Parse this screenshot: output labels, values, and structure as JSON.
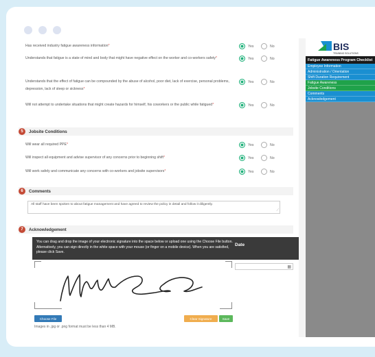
{
  "questions": [
    {
      "text": "Has received industry fatigue awareness information",
      "required": "*",
      "yes": "Yes",
      "no": "No"
    },
    {
      "text": "Understands that fatigue is a state of mind and body that might have negative effect on the worker and co-workers safety",
      "required": "*",
      "yes": "Yes",
      "no": "No"
    },
    {
      "text": "Understands that the effect of fatigue can be compounded by the abuse of alcohol, poor diet, lack of exercise, personal problems, depression, lack of sleep or sickness",
      "required": "*",
      "yes": "Yes",
      "no": "No"
    },
    {
      "text": "Will not attempt to undertake situations that might create hazards for himself, his coworkers or the public while fatigued",
      "required": "*",
      "yes": "Yes",
      "no": "No"
    }
  ],
  "sections": {
    "jobsite": {
      "number": "5",
      "title": "Jobsite Conditions"
    },
    "comments": {
      "number": "6",
      "title": "Comments"
    },
    "ack": {
      "number": "7",
      "title": "Acknowledgement"
    }
  },
  "jobsite_questions": [
    {
      "text": "Will wear all required PPE",
      "required": "*",
      "yes": "Yes",
      "no": "No"
    },
    {
      "text": "Will inspect all equipment and advise supervisor of any concerns prior to beginning shift",
      "required": "*",
      "yes": "Yes",
      "no": "No"
    },
    {
      "text": "Will work safely and communicate any concerns with co-workers and jobsite supervisors",
      "required": "*",
      "yes": "Yes",
      "no": "No"
    }
  ],
  "comments_value": "All staff have been spoken to about fatigue management and have agreed to review the policy in detail and follow it diligently.",
  "ack": {
    "instructions": "You can drag and drop the image of your electronic signature into the space below or upload one using the Choose File button. Alternatively, you can sign directly in the white space with your mouse (or finger on a mobile device). When you are satisfied, please click Save.",
    "date_label": "Date",
    "choose_file": "Choose File",
    "clear_signature": "Clear Signature",
    "save": "Save",
    "file_note": "Images in .jpg or .png format must be less than 4 MB."
  },
  "sidebar": {
    "logo_text": "BIS",
    "logo_sub": "TRAINING SOLUTIONS",
    "title": "Fatigue Awareness Program Checklist",
    "items": [
      {
        "label": "Employee Information",
        "color": "#1a8fd1"
      },
      {
        "label": "Administration / Orientation",
        "color": "#1a8fd1"
      },
      {
        "label": "Shift Duration Requirement",
        "color": "#1a8fd1"
      },
      {
        "label": "Fatigue Awareness",
        "color": "#1fa24a"
      },
      {
        "label": "Jobsite Conditions",
        "color": "#1fa24a"
      },
      {
        "label": "Comments",
        "color": "#1a8fd1"
      },
      {
        "label": "Acknowledgement",
        "color": "#1a8fd1"
      }
    ]
  },
  "colors": {
    "accent_green": "#1fb17a",
    "section_badge": "#c44a36",
    "btn_blue": "#337ab7",
    "btn_orange": "#f0ad4e",
    "btn_green": "#5cb85c"
  }
}
